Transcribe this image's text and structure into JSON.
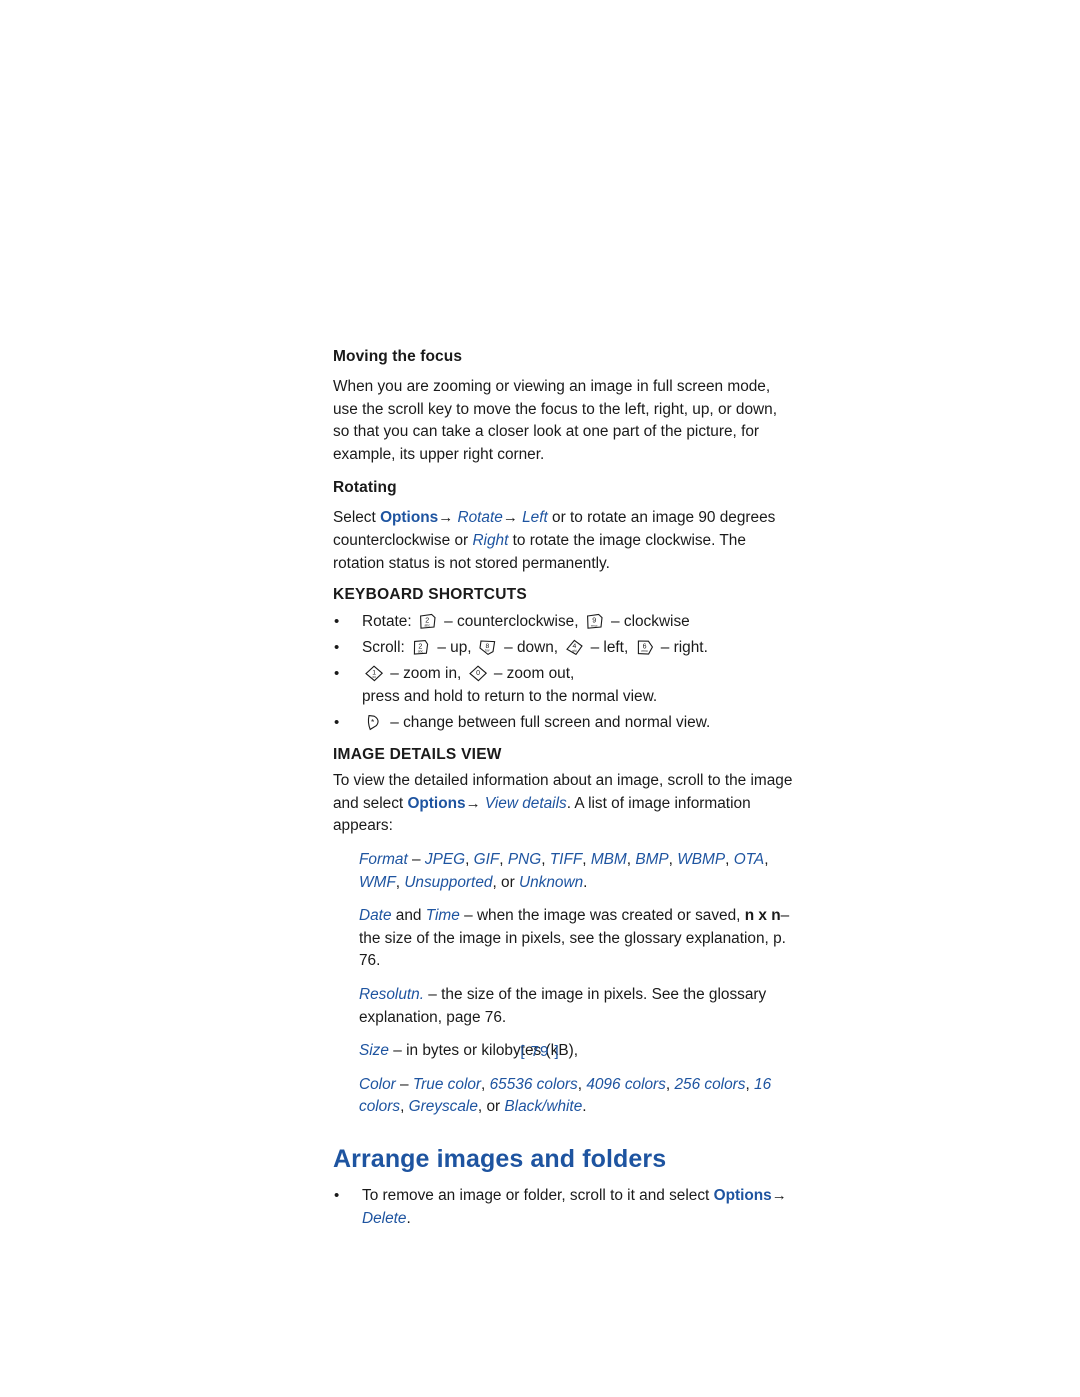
{
  "page": {
    "folio": "[ 79 ]"
  },
  "colors": {
    "accent_blue": "#1e54a0",
    "body_text": "#1a1a1a",
    "page_background": "#ffffff"
  },
  "sections": {
    "moving_focus": {
      "heading": "Moving the focus",
      "body": "When you are zooming or viewing an image in full screen mode, use the scroll key to move the focus to the left, right, up, or down, so that you can take a closer look at one part of the picture, for example, its upper right corner."
    },
    "rotating": {
      "heading": "Rotating",
      "lead": "Select ",
      "options": "Options",
      "arrow1": "→",
      "rotate": " Rotate",
      "arrow2": "→",
      "left": " Left",
      "mid": " or to rotate an image 90 degrees counterclockwise or ",
      "right": "Right",
      "tail": " to rotate the image clockwise. The rotation status is not stored permanently."
    },
    "keyboard_shortcuts": {
      "heading": "KEYBOARD SHORTCUTS",
      "items": [
        {
          "label": "Rotate:",
          "key1": "2",
          "key1_sub": "abc",
          "text1": " – counterclockwise, ",
          "key2": "9",
          "key2_sub": "wxyz",
          "text2": " – clockwise"
        },
        {
          "label": "Scroll:",
          "key1": "2",
          "key1_sub": "abc",
          "text1": " – up, ",
          "key2": "8",
          "key2_sub": "tuv",
          "text2": " – down, ",
          "key3": "4",
          "key3_sub": "ghi",
          "text3": " – left, ",
          "key4": "6",
          "key4_sub": "mno",
          "text4": " – right."
        },
        {
          "key1": "1",
          "key1_sub": "oo",
          "text1": " – zoom in, ",
          "key2": "0",
          "key2_sub": "",
          "text2": " – zoom out,",
          "line2": "press and hold to return to the normal view."
        },
        {
          "key1": "*",
          "key1_sub": "",
          "text1": " – change between full screen and normal view."
        }
      ]
    },
    "image_details_view": {
      "heading": "IMAGE DETAILS VIEW",
      "intro_a": "To view the detailed information about an image, scroll to the image and select ",
      "options": "Options",
      "arrow": "→",
      "view_details": " View details",
      "intro_b": ". A list of image information appears:",
      "format_line": {
        "term": "Format",
        "dash": " – ",
        "values": [
          "JPEG",
          "GIF",
          "PNG",
          "TIFF",
          "MBM",
          "BMP",
          "WBMP",
          "OTA",
          "WMF",
          "Unsupported"
        ],
        "or": ", or ",
        "last": "Unknown",
        "period": "."
      },
      "date_line": {
        "term1": "Date",
        "and": " and ",
        "term2": "Time",
        "text_a": " – when the image was created or saved, ",
        "bold": "n x n",
        "text_b": "– the size of the image in pixels, see the glossary explanation, p. 76."
      },
      "resolution_line": {
        "term": "Resolutn.",
        "text": " – the size of the image in pixels.  See the glossary explanation, page 76."
      },
      "size_line": {
        "term": "Size",
        "text": " – in bytes or kilobytes (kB),"
      },
      "color_line": {
        "term": "Color",
        "dash": " – ",
        "values": [
          "True color",
          "65536 colors",
          "4096 colors",
          "256 colors",
          "16 colors",
          "Greyscale"
        ],
        "or": ", or ",
        "last": "Black/white",
        "period": "."
      }
    },
    "arrange": {
      "heading": "Arrange images and folders",
      "bullet": {
        "text_a": "To remove an image or folder, scroll to it and select ",
        "options": "Options",
        "arrow": "→",
        "delete": " Delete",
        "period": "."
      }
    }
  }
}
